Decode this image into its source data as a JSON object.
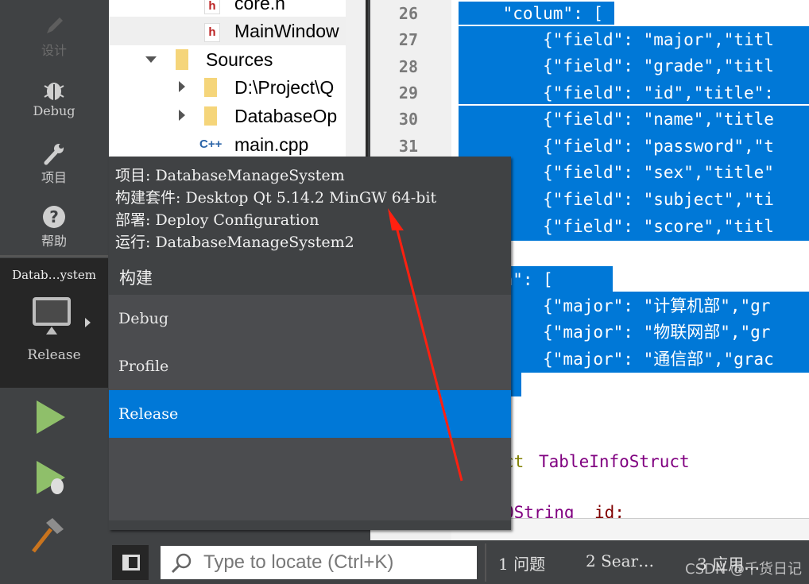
{
  "sidebar": {
    "modes": [
      {
        "label": "设计",
        "icon": "pencil-icon",
        "enabled": false
      },
      {
        "label": "Debug",
        "icon": "bug-icon",
        "enabled": true
      },
      {
        "label": "项目",
        "icon": "wrench-icon",
        "enabled": true
      },
      {
        "label": "帮助",
        "icon": "help-icon",
        "enabled": true
      }
    ],
    "target": {
      "project": "Datab…ystem",
      "config": "Release",
      "icon": "monitor-icon"
    },
    "actions": [
      "run-icon",
      "debug-run-icon",
      "hammer-icon"
    ]
  },
  "tree": {
    "items": [
      "core.h",
      "MainWindow",
      "Sources",
      "D:\\Project\\Q",
      "DatabaseOp",
      "main.cpp"
    ]
  },
  "editor": {
    "line_numbers": [
      "26",
      "27",
      "28",
      "29",
      "30",
      "31"
    ],
    "lines": [
      "    \"colum\": [",
      "        {\"field\": \"major\",\"titl",
      "        {\"field\": \"grade\",\"titl",
      "        {\"field\": \"id\",\"title\":",
      "        {\"field\": \"name\",\"title",
      "        {\"field\": \"password\",\"t",
      "        {\"field\": \"sex\",\"title\"",
      "        {\"field\": \"subject\",\"ti",
      "        {\"field\": \"score\",\"titl",
      "],",
      "\"data\": [",
      "        {\"major\": \"计算机部\",\"gr",
      "        {\"major\": \"物联网部\",\"gr",
      "        {\"major\": \"通信部\",\"grac"
    ],
    "struct_kw": "ct",
    "struct_name": "TableInfoStruct",
    "member_type": "QString",
    "member_name": "id;"
  },
  "popup": {
    "info": [
      "项目: DatabaseManageSystem",
      "构建套件: Desktop Qt 5.14.2 MinGW 64-bit",
      "部署: Deploy Configuration",
      "运行: DatabaseManageSystem2"
    ],
    "build_header": "构建",
    "build_options": [
      "Debug",
      "Profile",
      "Release"
    ],
    "selected": "Release"
  },
  "bottom": {
    "search_placeholder": "Type to locate (Ctrl+K)",
    "tabs": [
      "1  问题",
      "2  Sear…",
      "3  应用…"
    ]
  },
  "watermark": "CSDN @千货日记",
  "colors": {
    "selection": "#0078d7",
    "sidebar": "#404244",
    "run": "#8fbf6a",
    "annotation_arrow": "#ff2010"
  }
}
